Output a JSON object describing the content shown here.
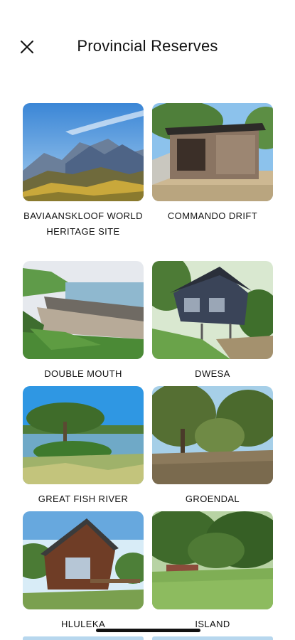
{
  "header": {
    "title": "Provincial Reserves",
    "close_icon": "close-icon"
  },
  "reserves": [
    {
      "name": "BAVIAANSKLOOF WORLD HERITAGE SITE"
    },
    {
      "name": "COMMANDO DRIFT"
    },
    {
      "name": "DOUBLE MOUTH"
    },
    {
      "name": "DWESA"
    },
    {
      "name": "GREAT FISH RIVER"
    },
    {
      "name": "GROENDAL"
    },
    {
      "name": "HLULEKA"
    },
    {
      "name": "ISLAND"
    }
  ]
}
